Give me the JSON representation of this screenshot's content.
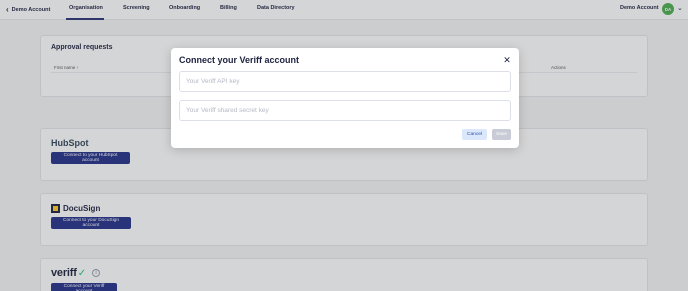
{
  "nav": {
    "back_label": "Demo Account",
    "tabs": [
      {
        "label": "Organisation",
        "active": true
      },
      {
        "label": "Screening",
        "active": false
      },
      {
        "label": "Onboarding",
        "active": false
      },
      {
        "label": "Billing",
        "active": false
      },
      {
        "label": "Data Directory",
        "active": false
      }
    ],
    "account_name": "Demo Account",
    "avatar_initials": "DA",
    "avatar_color": "#4caf50"
  },
  "approval": {
    "title": "Approval requests",
    "columns": [
      "First name ↑",
      "Actions"
    ]
  },
  "integrations": [
    {
      "brand": "HubSpot",
      "button_label": "Connect to your HubSpot account"
    },
    {
      "brand": "DocuSign",
      "button_label": "Connect to your DocuSign account"
    },
    {
      "brand": "veriff",
      "button_label": "Connect your Veriff account"
    }
  ],
  "modal": {
    "title": "Connect your Veriff account",
    "api_key_placeholder": "Your Veriff API key",
    "secret_placeholder": "Your Veriff shared secret key",
    "cancel_label": "Cancel",
    "save_label": "Save"
  },
  "colors": {
    "primary": "#24308a",
    "hubspot_accent": "#ff7a59",
    "veriff_accent": "#1ec78b"
  }
}
